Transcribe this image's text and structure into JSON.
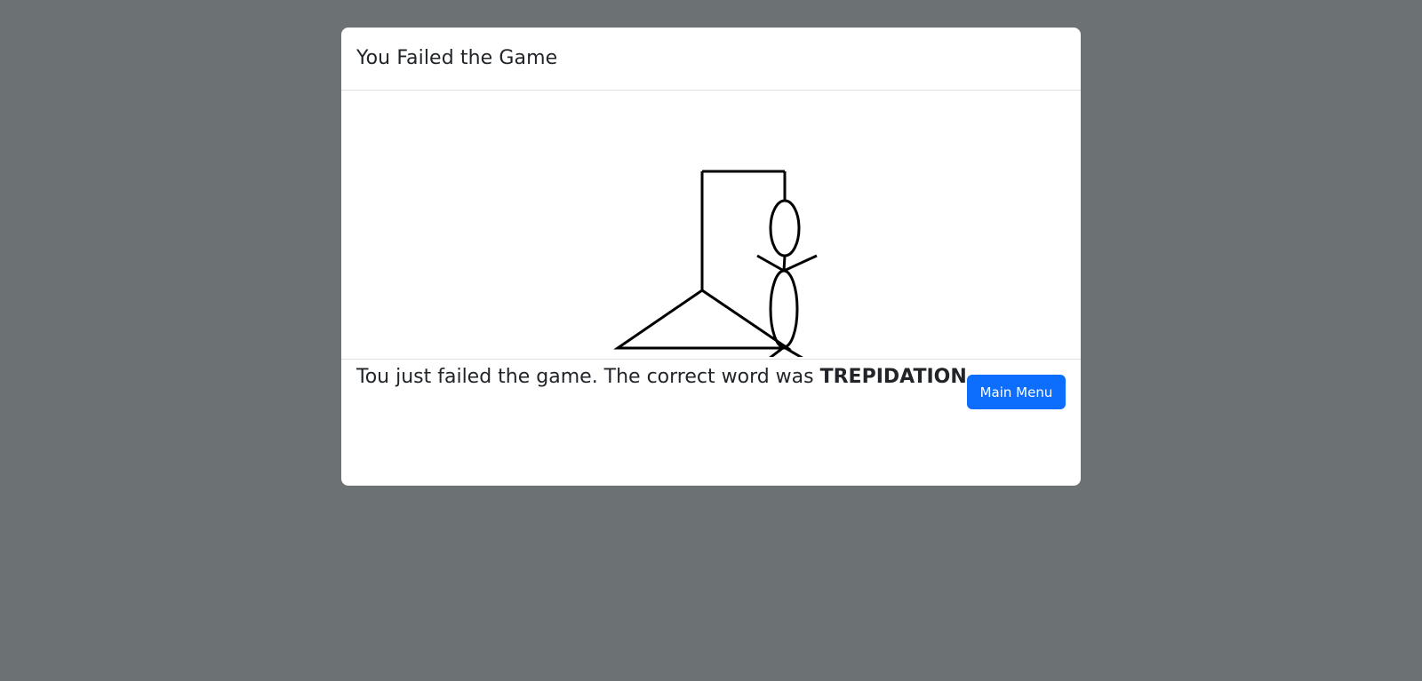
{
  "modal": {
    "title": "You Failed the Game",
    "message_prefix": "Tou just failed the game. The correct word was ",
    "correct_word": "TREPIDATION",
    "message_suffix": "."
  },
  "footer": {
    "main_menu_label": "Main Menu"
  },
  "drawing": {
    "parts_shown": [
      "base",
      "pole",
      "beam",
      "rope",
      "head",
      "body",
      "left-arm",
      "right-arm",
      "left-leg",
      "right-leg"
    ]
  }
}
